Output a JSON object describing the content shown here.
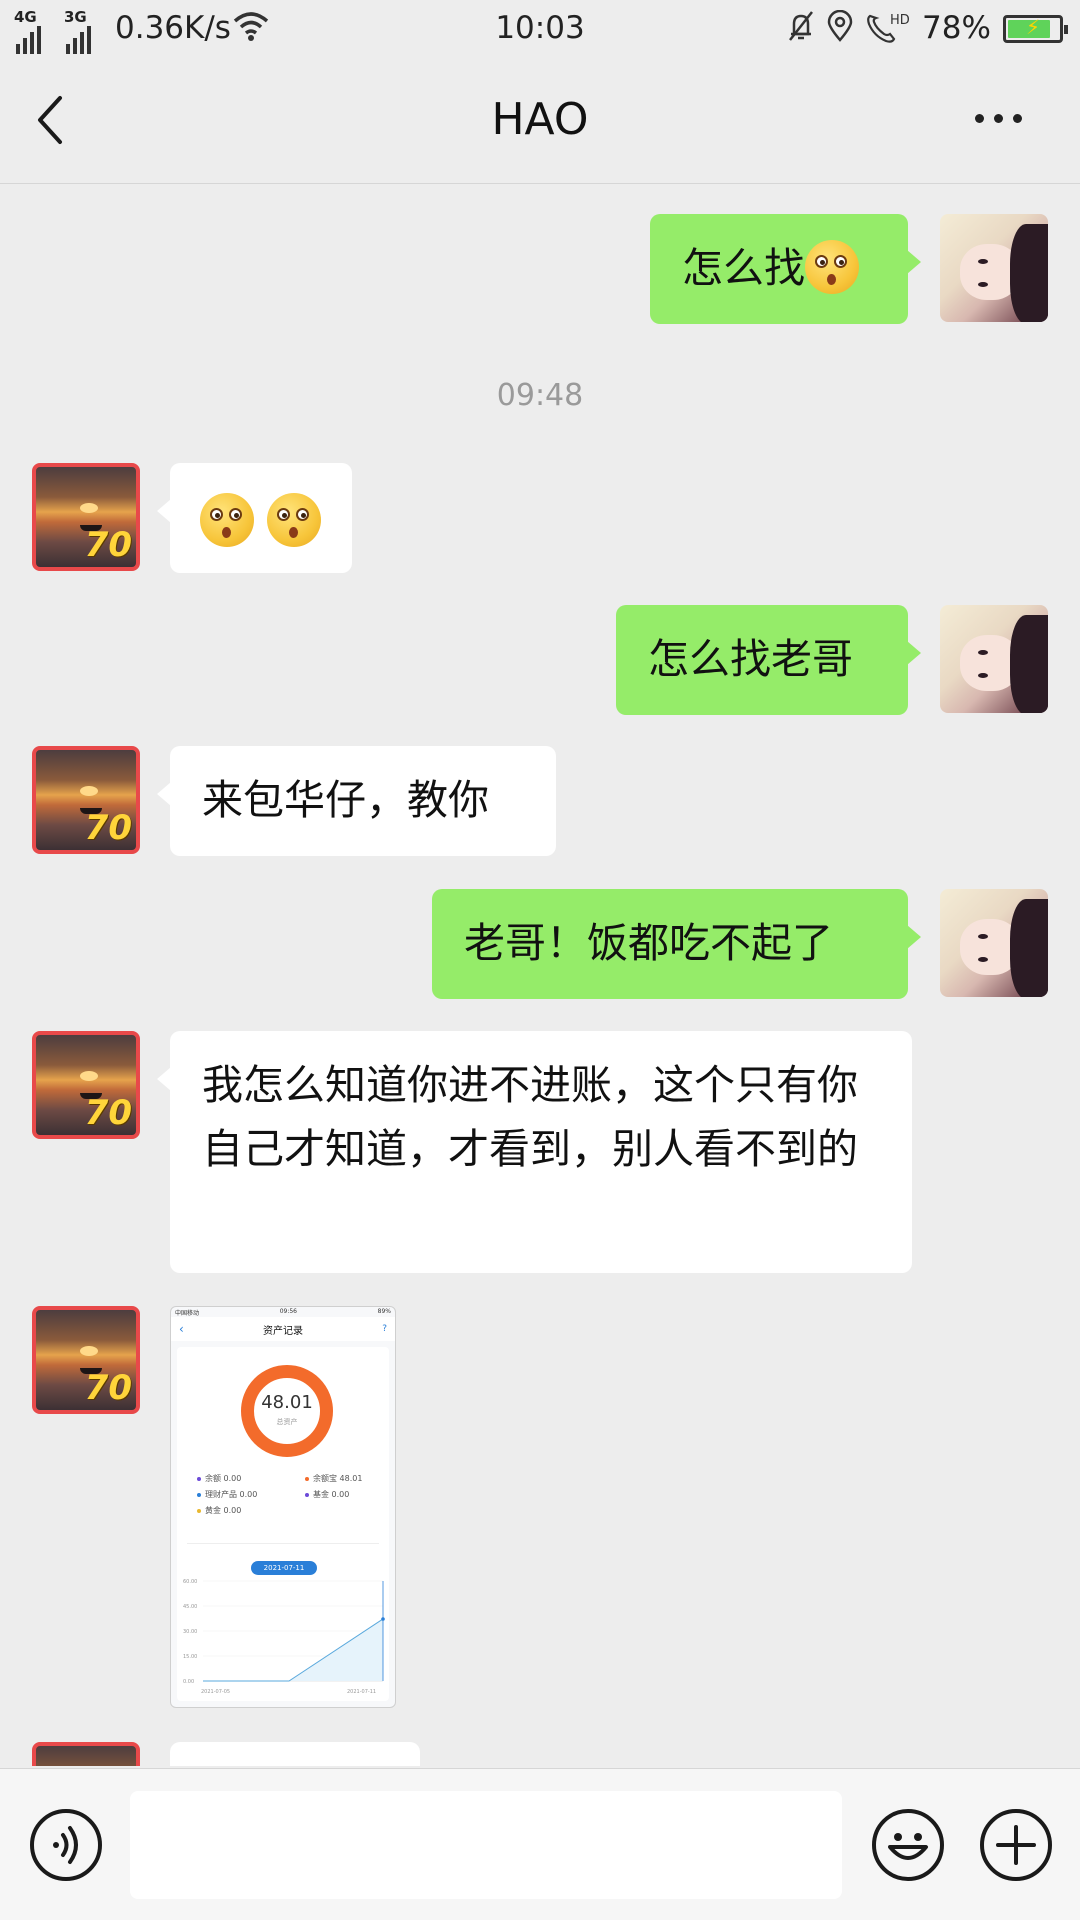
{
  "status_bar": {
    "signal1_tech": "4G",
    "signal2_tech": "3G",
    "net_speed": "0.36K/s",
    "time": "10:03",
    "battery_pct": "78%",
    "battery_level": 0.78,
    "icons": [
      "bell-off-icon",
      "location-icon",
      "hd-call-icon",
      "wifi-icon"
    ]
  },
  "header": {
    "title": "HAO",
    "back_icon": "chevron-left-icon",
    "more_icon": "more-dots-icon"
  },
  "messages": [
    {
      "side": "me",
      "text": "怎么找",
      "emoji": "thinking-face"
    },
    {
      "side": "peer",
      "text": "",
      "emoji": "flushed-face x2"
    },
    {
      "side": "me",
      "text": "怎么找老哥"
    },
    {
      "side": "peer",
      "text": "来包华仔，教你"
    },
    {
      "side": "me",
      "text": "老哥！饭都吃不起了"
    },
    {
      "side": "peer",
      "text": "我怎么知道你进不进账，这个只有你自己才知道，才看到，别人看不到的"
    }
  ],
  "timestamp": "09:48",
  "image_message": {
    "status_carrier": "中国移动",
    "status_time": "09:56",
    "status_battery": "89%",
    "title": "资产记录",
    "total": "48.01",
    "total_label": "总资产",
    "legend": [
      {
        "label": "余额",
        "value": "0.00",
        "color": "#6c4bd8"
      },
      {
        "label": "余额宝",
        "value": "48.01",
        "color": "#f36b2b"
      },
      {
        "label": "理财产品",
        "value": "0.00",
        "color": "#2a7fd8"
      },
      {
        "label": "基金",
        "value": "0.00",
        "color": "#6c4bd8"
      },
      {
        "label": "黄金",
        "value": "0.00",
        "color": "#e8b830"
      }
    ],
    "date_pill": "2021-07-11",
    "y_ticks": [
      "60.00",
      "45.00",
      "30.00",
      "15.00",
      "0.00"
    ],
    "x_start": "2021-07-05",
    "x_end": "2021-07-11"
  },
  "input_bar": {
    "voice_icon": "voice-icon",
    "emoji_icon": "emoji-icon",
    "plus_icon": "plus-icon",
    "placeholder": ""
  }
}
